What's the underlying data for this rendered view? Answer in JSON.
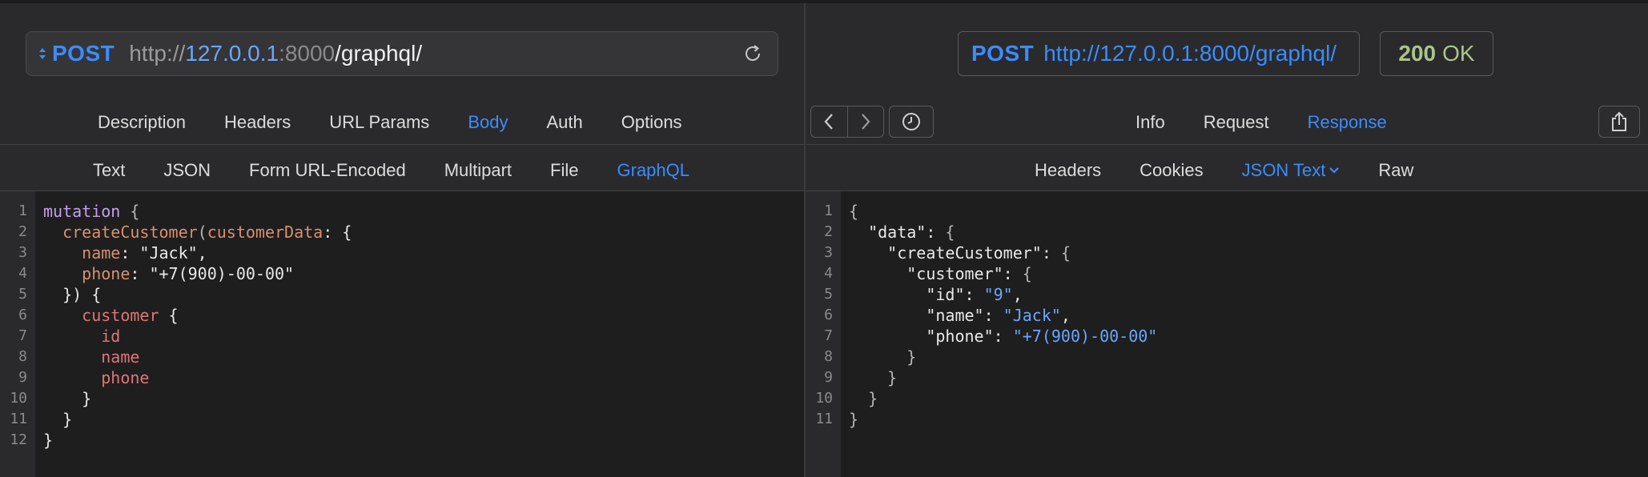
{
  "request": {
    "method": "POST",
    "url_scheme": "http://",
    "url_host": "127.0.0.1",
    "url_port_sep": ":",
    "url_port": "8000",
    "url_path": "/graphql/"
  },
  "request_tabs": [
    "Description",
    "Headers",
    "URL Params",
    "Body",
    "Auth",
    "Options"
  ],
  "request_tabs_active": "Body",
  "body_tabs": [
    "Text",
    "JSON",
    "Form URL-Encoded",
    "Multipart",
    "File",
    "GraphQL"
  ],
  "body_tabs_active": "GraphQL",
  "request_line_numbers": [
    "1",
    "2",
    "3",
    "4",
    "5",
    "6",
    "7",
    "8",
    "9",
    "10",
    "11",
    "12"
  ],
  "request_code": [
    [
      {
        "t": "mutation",
        "c": "kw"
      },
      {
        "t": " {",
        "c": "brace"
      }
    ],
    [
      {
        "t": "  ",
        "c": ""
      },
      {
        "t": "createCustomer",
        "c": "fn"
      },
      {
        "t": "(",
        "c": "brace"
      },
      {
        "t": "customerData",
        "c": "arg"
      },
      {
        "t": ": {",
        "c": ""
      }
    ],
    [
      {
        "t": "    ",
        "c": ""
      },
      {
        "t": "name",
        "c": "arg"
      },
      {
        "t": ": \"Jack\",",
        "c": "str"
      }
    ],
    [
      {
        "t": "    ",
        "c": ""
      },
      {
        "t": "phone",
        "c": "arg"
      },
      {
        "t": ": \"+7(900)-00-00\"",
        "c": "str"
      }
    ],
    [
      {
        "t": "  }) {",
        "c": ""
      }
    ],
    [
      {
        "t": "    ",
        "c": ""
      },
      {
        "t": "customer",
        "c": "fld"
      },
      {
        "t": " {",
        "c": ""
      }
    ],
    [
      {
        "t": "      ",
        "c": ""
      },
      {
        "t": "id",
        "c": "fld"
      }
    ],
    [
      {
        "t": "      ",
        "c": ""
      },
      {
        "t": "name",
        "c": "fld"
      }
    ],
    [
      {
        "t": "      ",
        "c": ""
      },
      {
        "t": "phone",
        "c": "fld"
      }
    ],
    [
      {
        "t": "    }",
        "c": ""
      }
    ],
    [
      {
        "t": "  }",
        "c": ""
      }
    ],
    [
      {
        "t": "}",
        "c": ""
      }
    ]
  ],
  "response": {
    "method": "POST",
    "url": "http://127.0.0.1:8000/graphql/",
    "status_code": "200",
    "status_text": "OK"
  },
  "response_tabs": [
    "Info",
    "Request",
    "Response"
  ],
  "response_tabs_active": "Response",
  "response_sub_tabs": [
    "Headers",
    "Cookies",
    "JSON Text",
    "Raw"
  ],
  "response_sub_tabs_active": "JSON Text",
  "response_line_numbers": [
    "1",
    "2",
    "3",
    "4",
    "5",
    "6",
    "7",
    "8",
    "9",
    "10",
    "11"
  ],
  "response_code": [
    [
      {
        "t": "{",
        "c": "brace"
      }
    ],
    [
      {
        "t": "  \"data\": ",
        "c": "jkey"
      },
      {
        "t": "{",
        "c": "brace"
      }
    ],
    [
      {
        "t": "    \"createCustomer\": ",
        "c": "jkey"
      },
      {
        "t": "{",
        "c": "brace"
      }
    ],
    [
      {
        "t": "      \"customer\": ",
        "c": "jkey"
      },
      {
        "t": "{",
        "c": "brace"
      }
    ],
    [
      {
        "t": "        \"id\": ",
        "c": "jkey"
      },
      {
        "t": "\"9\"",
        "c": "jstr"
      },
      {
        "t": ",",
        "c": ""
      }
    ],
    [
      {
        "t": "        \"name\": ",
        "c": "jkey"
      },
      {
        "t": "\"Jack\"",
        "c": "jstr"
      },
      {
        "t": ",",
        "c": ""
      }
    ],
    [
      {
        "t": "        \"phone\": ",
        "c": "jkey"
      },
      {
        "t": "\"+7(900)-00-00\"",
        "c": "jstr"
      }
    ],
    [
      {
        "t": "      }",
        "c": "brace"
      }
    ],
    [
      {
        "t": "    }",
        "c": "brace"
      }
    ],
    [
      {
        "t": "  }",
        "c": "brace"
      }
    ],
    [
      {
        "t": "}",
        "c": "brace"
      }
    ]
  ],
  "icons": {
    "method_switcher": "up-down-arrows-icon",
    "reload": "reload-icon",
    "back": "chevron-left-icon",
    "forward": "chevron-right-icon",
    "history": "clock-icon",
    "share": "share-icon",
    "dropdown": "chevron-down-icon"
  },
  "colors": {
    "accent": "#3b8cff",
    "status_ok": "#a9c58a",
    "keyword": "#c89cf0",
    "function": "#d79070",
    "field": "#e07575",
    "json_string": "#6aa6ff"
  }
}
